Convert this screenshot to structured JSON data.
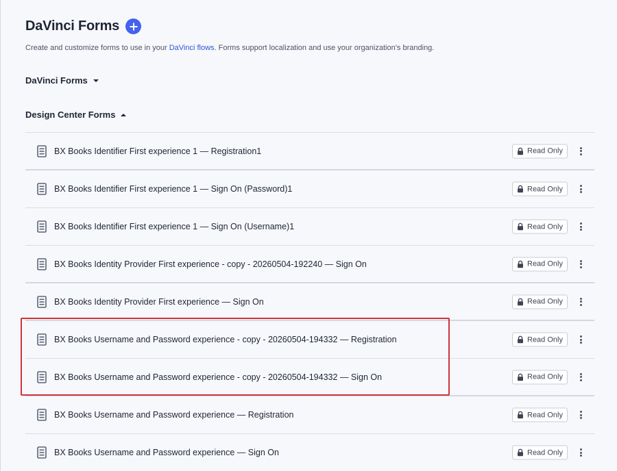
{
  "header": {
    "title": "DaVinci Forms",
    "add_icon": "plus-icon",
    "accent_color": "#4462ed"
  },
  "subtitle": {
    "prefix": "Create and customize forms to use in your ",
    "link": "DaVinci flows",
    "suffix": ". Forms support localization and use your organization’s branding."
  },
  "sections": {
    "davinci_forms": {
      "label": "DaVinci Forms",
      "state": "collapsed"
    },
    "design_center_forms": {
      "label": "Design Center Forms",
      "state": "expanded"
    }
  },
  "badge_label": "Read Only",
  "highlight_color": "#d0323a",
  "rows": [
    {
      "label": "BX Books Identifier First experience 1 — Registration1"
    },
    {
      "label": "BX Books Identifier First experience 1 — Sign On (Password)1"
    },
    {
      "label": "BX Books Identifier First experience 1 — Sign On (Username)1"
    },
    {
      "label": "BX Books Identity Provider First experience - copy - 20260504-192240 — Sign On"
    },
    {
      "label": "BX Books Identity Provider First experience — Sign On"
    },
    {
      "label": "BX Books Username and Password experience - copy - 20260504-194332 — Registration"
    },
    {
      "label": "BX Books Username and Password experience - copy - 20260504-194332 — Sign On"
    },
    {
      "label": "BX Books Username and Password experience — Registration"
    },
    {
      "label": "BX Books Username and Password experience — Sign On"
    }
  ]
}
